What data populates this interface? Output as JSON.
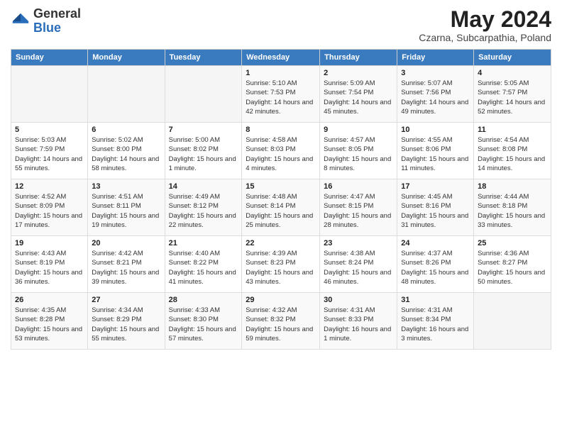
{
  "header": {
    "logo_general": "General",
    "logo_blue": "Blue",
    "month_title": "May 2024",
    "subtitle": "Czarna, Subcarpathia, Poland"
  },
  "weekdays": [
    "Sunday",
    "Monday",
    "Tuesday",
    "Wednesday",
    "Thursday",
    "Friday",
    "Saturday"
  ],
  "weeks": [
    [
      {
        "day": "",
        "sunrise": "",
        "sunset": "",
        "daylight": ""
      },
      {
        "day": "",
        "sunrise": "",
        "sunset": "",
        "daylight": ""
      },
      {
        "day": "",
        "sunrise": "",
        "sunset": "",
        "daylight": ""
      },
      {
        "day": "1",
        "sunrise": "Sunrise: 5:10 AM",
        "sunset": "Sunset: 7:53 PM",
        "daylight": "Daylight: 14 hours and 42 minutes."
      },
      {
        "day": "2",
        "sunrise": "Sunrise: 5:09 AM",
        "sunset": "Sunset: 7:54 PM",
        "daylight": "Daylight: 14 hours and 45 minutes."
      },
      {
        "day": "3",
        "sunrise": "Sunrise: 5:07 AM",
        "sunset": "Sunset: 7:56 PM",
        "daylight": "Daylight: 14 hours and 49 minutes."
      },
      {
        "day": "4",
        "sunrise": "Sunrise: 5:05 AM",
        "sunset": "Sunset: 7:57 PM",
        "daylight": "Daylight: 14 hours and 52 minutes."
      }
    ],
    [
      {
        "day": "5",
        "sunrise": "Sunrise: 5:03 AM",
        "sunset": "Sunset: 7:59 PM",
        "daylight": "Daylight: 14 hours and 55 minutes."
      },
      {
        "day": "6",
        "sunrise": "Sunrise: 5:02 AM",
        "sunset": "Sunset: 8:00 PM",
        "daylight": "Daylight: 14 hours and 58 minutes."
      },
      {
        "day": "7",
        "sunrise": "Sunrise: 5:00 AM",
        "sunset": "Sunset: 8:02 PM",
        "daylight": "Daylight: 15 hours and 1 minute."
      },
      {
        "day": "8",
        "sunrise": "Sunrise: 4:58 AM",
        "sunset": "Sunset: 8:03 PM",
        "daylight": "Daylight: 15 hours and 4 minutes."
      },
      {
        "day": "9",
        "sunrise": "Sunrise: 4:57 AM",
        "sunset": "Sunset: 8:05 PM",
        "daylight": "Daylight: 15 hours and 8 minutes."
      },
      {
        "day": "10",
        "sunrise": "Sunrise: 4:55 AM",
        "sunset": "Sunset: 8:06 PM",
        "daylight": "Daylight: 15 hours and 11 minutes."
      },
      {
        "day": "11",
        "sunrise": "Sunrise: 4:54 AM",
        "sunset": "Sunset: 8:08 PM",
        "daylight": "Daylight: 15 hours and 14 minutes."
      }
    ],
    [
      {
        "day": "12",
        "sunrise": "Sunrise: 4:52 AM",
        "sunset": "Sunset: 8:09 PM",
        "daylight": "Daylight: 15 hours and 17 minutes."
      },
      {
        "day": "13",
        "sunrise": "Sunrise: 4:51 AM",
        "sunset": "Sunset: 8:11 PM",
        "daylight": "Daylight: 15 hours and 19 minutes."
      },
      {
        "day": "14",
        "sunrise": "Sunrise: 4:49 AM",
        "sunset": "Sunset: 8:12 PM",
        "daylight": "Daylight: 15 hours and 22 minutes."
      },
      {
        "day": "15",
        "sunrise": "Sunrise: 4:48 AM",
        "sunset": "Sunset: 8:14 PM",
        "daylight": "Daylight: 15 hours and 25 minutes."
      },
      {
        "day": "16",
        "sunrise": "Sunrise: 4:47 AM",
        "sunset": "Sunset: 8:15 PM",
        "daylight": "Daylight: 15 hours and 28 minutes."
      },
      {
        "day": "17",
        "sunrise": "Sunrise: 4:45 AM",
        "sunset": "Sunset: 8:16 PM",
        "daylight": "Daylight: 15 hours and 31 minutes."
      },
      {
        "day": "18",
        "sunrise": "Sunrise: 4:44 AM",
        "sunset": "Sunset: 8:18 PM",
        "daylight": "Daylight: 15 hours and 33 minutes."
      }
    ],
    [
      {
        "day": "19",
        "sunrise": "Sunrise: 4:43 AM",
        "sunset": "Sunset: 8:19 PM",
        "daylight": "Daylight: 15 hours and 36 minutes."
      },
      {
        "day": "20",
        "sunrise": "Sunrise: 4:42 AM",
        "sunset": "Sunset: 8:21 PM",
        "daylight": "Daylight: 15 hours and 39 minutes."
      },
      {
        "day": "21",
        "sunrise": "Sunrise: 4:40 AM",
        "sunset": "Sunset: 8:22 PM",
        "daylight": "Daylight: 15 hours and 41 minutes."
      },
      {
        "day": "22",
        "sunrise": "Sunrise: 4:39 AM",
        "sunset": "Sunset: 8:23 PM",
        "daylight": "Daylight: 15 hours and 43 minutes."
      },
      {
        "day": "23",
        "sunrise": "Sunrise: 4:38 AM",
        "sunset": "Sunset: 8:24 PM",
        "daylight": "Daylight: 15 hours and 46 minutes."
      },
      {
        "day": "24",
        "sunrise": "Sunrise: 4:37 AM",
        "sunset": "Sunset: 8:26 PM",
        "daylight": "Daylight: 15 hours and 48 minutes."
      },
      {
        "day": "25",
        "sunrise": "Sunrise: 4:36 AM",
        "sunset": "Sunset: 8:27 PM",
        "daylight": "Daylight: 15 hours and 50 minutes."
      }
    ],
    [
      {
        "day": "26",
        "sunrise": "Sunrise: 4:35 AM",
        "sunset": "Sunset: 8:28 PM",
        "daylight": "Daylight: 15 hours and 53 minutes."
      },
      {
        "day": "27",
        "sunrise": "Sunrise: 4:34 AM",
        "sunset": "Sunset: 8:29 PM",
        "daylight": "Daylight: 15 hours and 55 minutes."
      },
      {
        "day": "28",
        "sunrise": "Sunrise: 4:33 AM",
        "sunset": "Sunset: 8:30 PM",
        "daylight": "Daylight: 15 hours and 57 minutes."
      },
      {
        "day": "29",
        "sunrise": "Sunrise: 4:32 AM",
        "sunset": "Sunset: 8:32 PM",
        "daylight": "Daylight: 15 hours and 59 minutes."
      },
      {
        "day": "30",
        "sunrise": "Sunrise: 4:31 AM",
        "sunset": "Sunset: 8:33 PM",
        "daylight": "Daylight: 16 hours and 1 minute."
      },
      {
        "day": "31",
        "sunrise": "Sunrise: 4:31 AM",
        "sunset": "Sunset: 8:34 PM",
        "daylight": "Daylight: 16 hours and 3 minutes."
      },
      {
        "day": "",
        "sunrise": "",
        "sunset": "",
        "daylight": ""
      }
    ]
  ]
}
